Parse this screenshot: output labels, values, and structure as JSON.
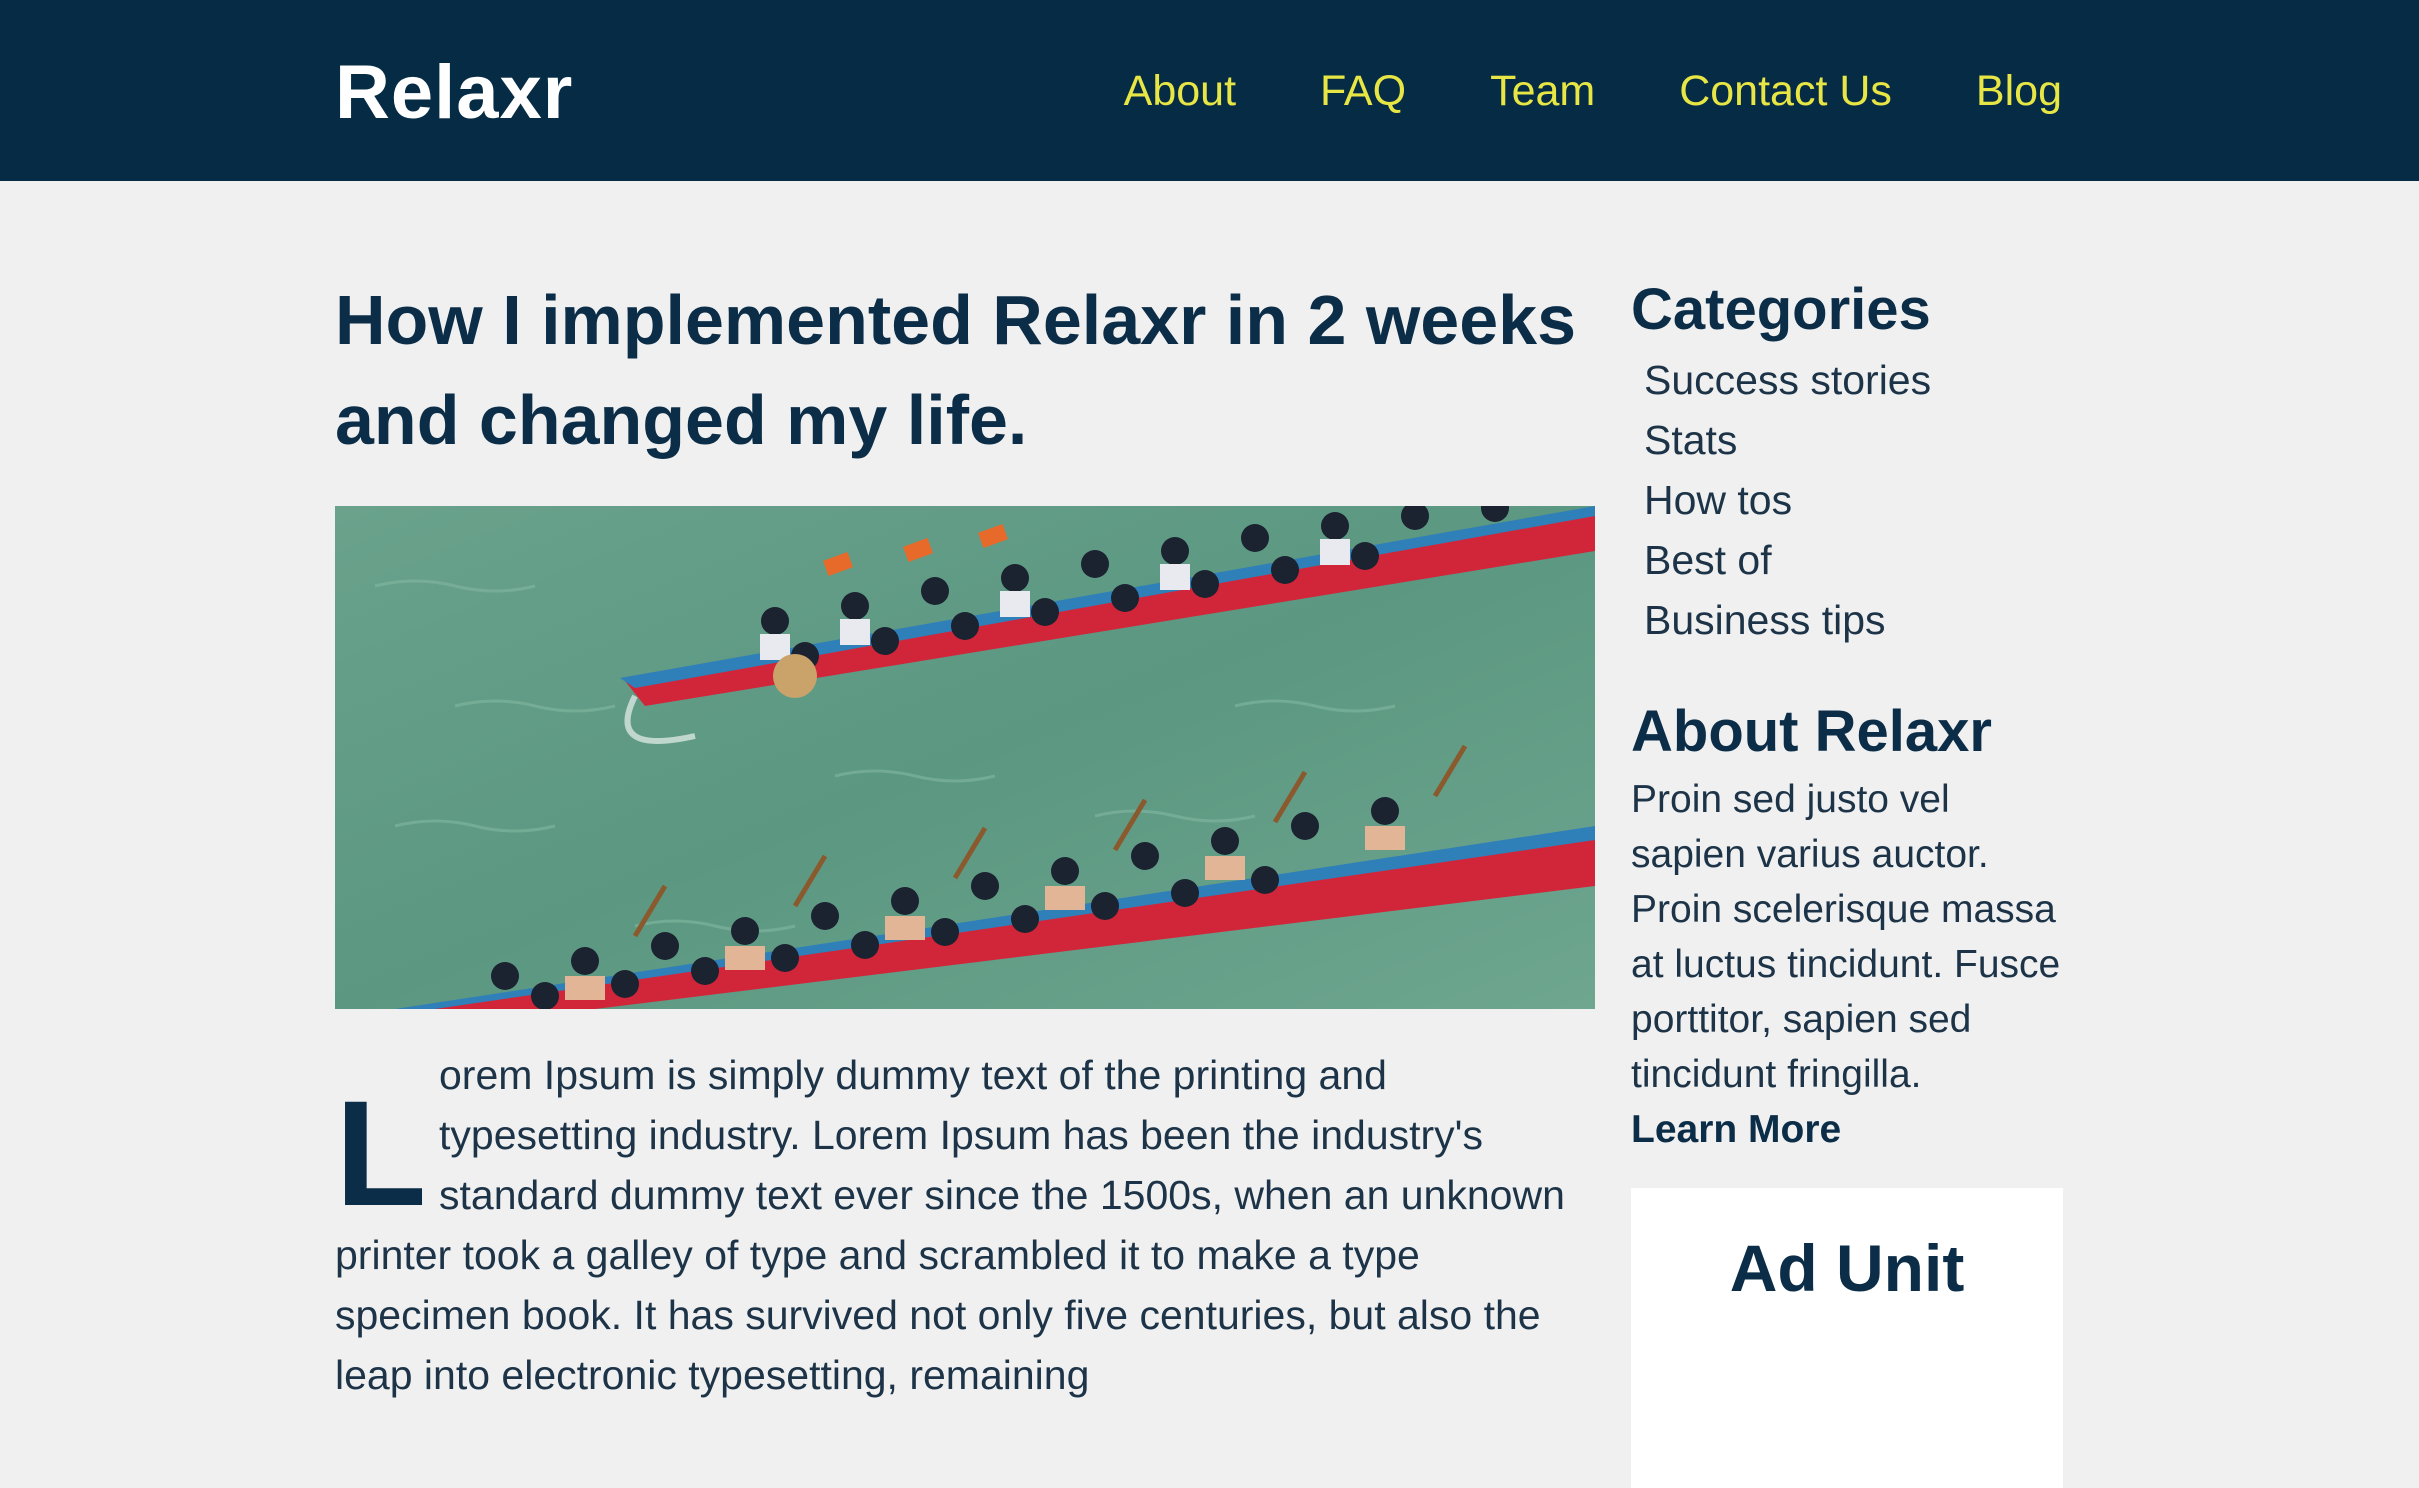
{
  "header": {
    "logo": "Relaxr",
    "nav": [
      {
        "label": "About"
      },
      {
        "label": "FAQ"
      },
      {
        "label": "Team"
      },
      {
        "label": "Contact Us"
      },
      {
        "label": "Blog"
      }
    ]
  },
  "colors": {
    "header_bg": "#062c45",
    "nav_link": "#e7e645",
    "heading": "#0b2d47",
    "page_bg": "#f0f0f0"
  },
  "post": {
    "title": "How I implemented Relaxr in 2 weeks and changed my life.",
    "image_icon": "dragon-boat-race-photo",
    "dropcap": "L",
    "body": "orem Ipsum is simply dummy text of the printing and typesetting industry. Lorem Ipsum has been the industry's standard dummy text ever since the 1500s, when an unknown printer took a galley of type and scrambled it to make a type specimen book. It has survived not only five centuries, but also the leap into electronic typesetting, remaining"
  },
  "sidebar": {
    "categories_heading": "Categories",
    "categories": [
      {
        "label": "Success stories"
      },
      {
        "label": "Stats"
      },
      {
        "label": "How tos"
      },
      {
        "label": "Best of"
      },
      {
        "label": "Business tips"
      }
    ],
    "about_heading": "About Relaxr",
    "about_text": "Proin sed justo vel sapien varius auctor. Proin scelerisque massa at luctus tincidunt. Fusce porttitor, sapien sed tincidunt fringilla.",
    "learn_more": "Learn More",
    "ad_label": "Ad Unit"
  }
}
